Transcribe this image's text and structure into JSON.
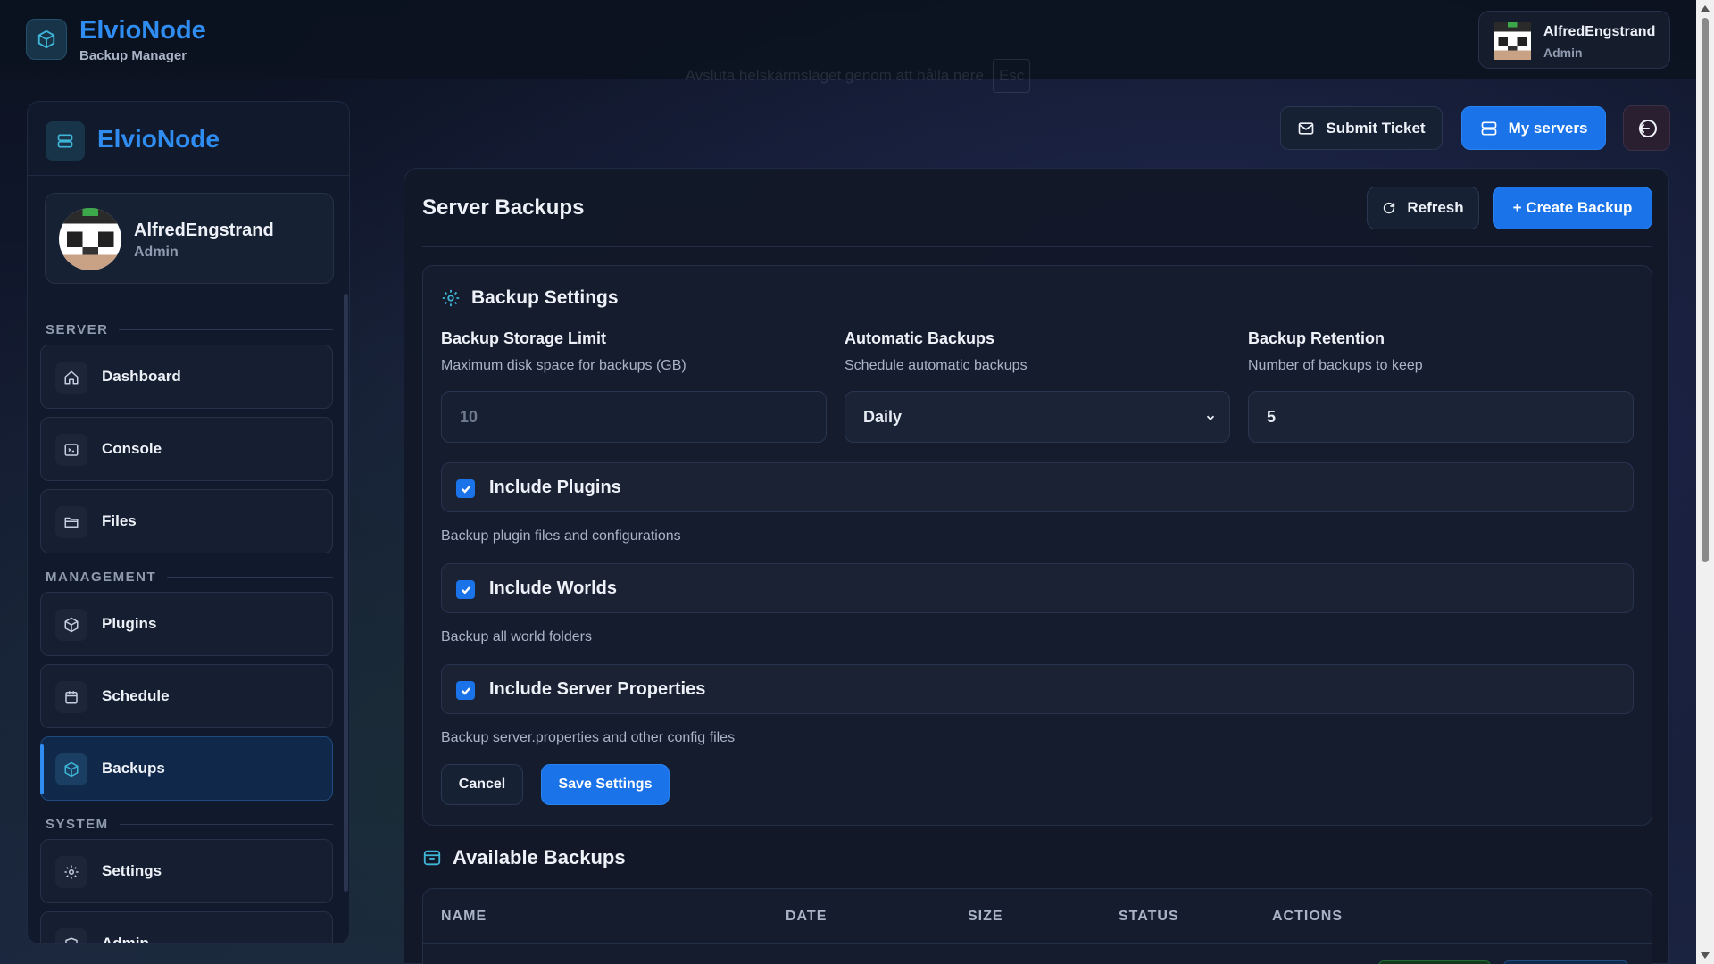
{
  "app": {
    "brand": "ElvioNode",
    "subtitle": "Backup Manager",
    "fullscreen_hint": "Avsluta helskärmsläget genom att hålla nere",
    "fullscreen_key": "Esc"
  },
  "user": {
    "name": "AlfredEngstrand",
    "role": "Admin"
  },
  "sidebar": {
    "brand": "ElvioNode",
    "sections": [
      {
        "label": "SERVER",
        "items": [
          {
            "label": "Dashboard",
            "icon": "home-icon"
          },
          {
            "label": "Console",
            "icon": "terminal-icon"
          },
          {
            "label": "Files",
            "icon": "folder-icon"
          }
        ]
      },
      {
        "label": "MANAGEMENT",
        "items": [
          {
            "label": "Plugins",
            "icon": "cube-icon"
          },
          {
            "label": "Schedule",
            "icon": "calendar-icon"
          },
          {
            "label": "Backups",
            "icon": "cube-icon",
            "active": true
          }
        ]
      },
      {
        "label": "SYSTEM",
        "items": [
          {
            "label": "Settings",
            "icon": "gear-icon"
          },
          {
            "label": "Admin",
            "icon": "shield-icon"
          }
        ]
      }
    ]
  },
  "header": {
    "submit_ticket": "Submit Ticket",
    "my_servers": "My servers"
  },
  "main": {
    "title": "Server Backups",
    "refresh": "Refresh",
    "create_backup": "+ Create Backup",
    "settings": {
      "title": "Backup Settings",
      "storage_limit": {
        "label": "Backup Storage Limit",
        "help": "Maximum disk space for backups (GB)",
        "placeholder": "10"
      },
      "automatic": {
        "label": "Automatic Backups",
        "help": "Schedule automatic backups",
        "value": "Daily"
      },
      "retention": {
        "label": "Backup Retention",
        "help": "Number of backups to keep",
        "value": "5"
      },
      "options": [
        {
          "label": "Include Plugins",
          "help": "Backup plugin files and configurations",
          "checked": true
        },
        {
          "label": "Include Worlds",
          "help": "Backup all world folders",
          "checked": true
        },
        {
          "label": "Include Server Properties",
          "help": "Backup server.properties and other config files",
          "checked": true
        }
      ],
      "cancel": "Cancel",
      "save": "Save Settings"
    },
    "available": {
      "title": "Available Backups",
      "columns": [
        "NAME",
        "DATE",
        "SIZE",
        "STATUS",
        "ACTIONS"
      ]
    }
  },
  "colors": {
    "accent": "#1a73e8",
    "brand": "#2f8cf0",
    "background": "#0d1526",
    "panel": "#141c2e"
  }
}
